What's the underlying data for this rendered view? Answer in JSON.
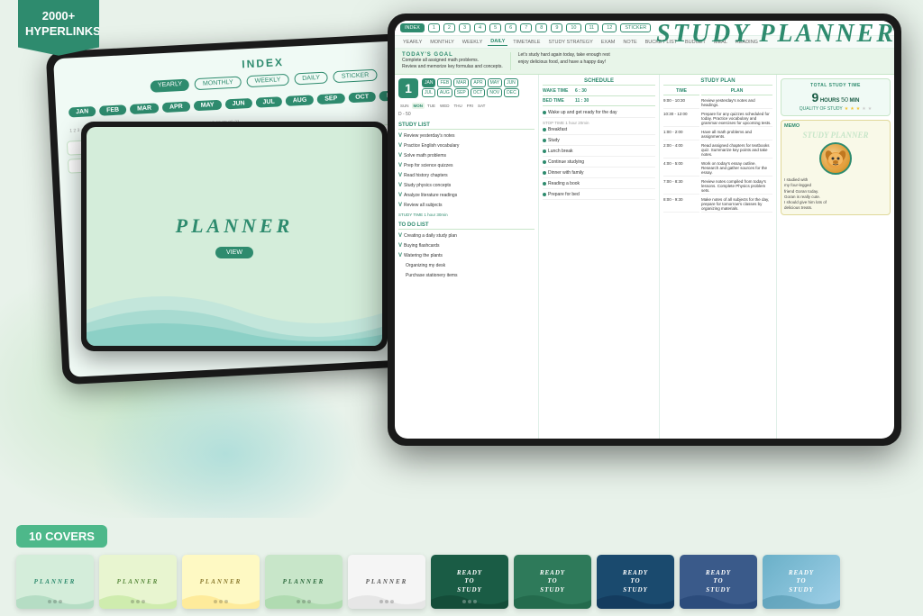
{
  "header": {
    "ribbon": "2000+\nHYPERLINKS",
    "title": "STUDY PLANNER"
  },
  "planner": {
    "nav_items": [
      "INDEX",
      "1",
      "2",
      "3",
      "4",
      "5",
      "6",
      "7",
      "8",
      "9",
      "10",
      "11",
      "12",
      "STICKER",
      "YEARLY",
      "MONTHLY",
      "WEEKLY",
      "DAILY",
      "TIMETABLE",
      "STUDY STRATEGY",
      "EXAM",
      "NOTE",
      "BUCKET LIST",
      "BUDGET",
      "MEAL",
      "READING"
    ],
    "date": "1",
    "months": [
      "JAN",
      "FEB",
      "MAR",
      "APR",
      "MAY",
      "JUN",
      "JUL",
      "AUG",
      "SEP",
      "OCT",
      "NOV",
      "DEC"
    ],
    "days": [
      "SUN",
      "MON",
      "TUE",
      "WED",
      "THU",
      "FRI",
      "SAT"
    ],
    "goal_label": "TODAY'S GOAL",
    "goal_text": "Complete all assigned math problems.\nReview and memorize key formulas and concepts.",
    "goal_right": "Let's study hard again today, take enough rest\nenjoy delicious food, and have a happy day!",
    "counter": "D - 50",
    "study_list_header": "STUDY LIST",
    "study_items": [
      "Review yesterday's notes",
      "Practice English vocabulary",
      "Solve math problems",
      "Prep for science quizzes",
      "Read history chapters",
      "Study physics concepts",
      "Analyze literature readings",
      "Review all subjects"
    ],
    "todo_header": "TO DO LIST",
    "todo_items": [
      "Creating a daily study plan",
      "Buying flashcards",
      "Watering the plants",
      "Organizing my desk",
      "Purchase stationery items"
    ],
    "schedule_header": "SCHEDULE",
    "wake_time": "6 : 30",
    "bed_time": "11 : 30",
    "schedule_items": [
      "Wake up and get ready for the day",
      "Breakfast",
      "Study",
      "Lunch break",
      "Continue studying",
      "Dinner with family",
      "Reading a book",
      "Prepare for bed"
    ],
    "study_plan_header": "STUDY PLAN",
    "time_slots": [
      "9:00 - 10:30",
      "10:30 - 12:00",
      "1:00 - 2:00",
      "2:00 - 4:00",
      "4:00 - 5:00",
      "7:00 - 8:30",
      "8:00 - 9:30"
    ],
    "plan_items": [
      "Review yesterday's notes and headings.",
      "Prepare for any quizzes scheduled for today. Practice vocabulary and grammar exercises for upcoming tests.",
      "Have all math problems and assignments.",
      "Read assigned chapters for textbooks quiz. Summarize key points and take notes.",
      "Work on today's essay outline. Research and gather sources for the essay.",
      "Review notes compiled from today's lessons. Complete Physics problem sets.",
      "Make notes of all subjects for the day, prepare for tomorrow's classes by organizing materials."
    ],
    "total_time_label": "TOTAL STUDY TIME",
    "total_hours": "9",
    "total_min": "50",
    "quality_label": "QUALITY OF STUDY",
    "memo_label": "MEMO",
    "memo_text": "I studied with\nmy four-legged\nfriend Goran today.\nGoran is really cute.\nI should give him lots of\ndelicious treats."
  },
  "covers_section": {
    "badge": "10 COVERS",
    "covers": [
      {
        "label": "PLANNER",
        "bg": "#d4edda",
        "text_color": "#2e8b6e",
        "type": "light"
      },
      {
        "label": "PLANNER",
        "bg": "#e8f5d0",
        "text_color": "#5a8a3e",
        "type": "light"
      },
      {
        "label": "PLANNER",
        "bg": "#fef9c3",
        "text_color": "#8a7a2e",
        "type": "light"
      },
      {
        "label": "PLANNER",
        "bg": "#c8e6c9",
        "text_color": "#2e6b3e",
        "type": "light"
      },
      {
        "label": "PLANNER",
        "bg": "#f5f5f5",
        "text_color": "#5a5a5a",
        "type": "light"
      },
      {
        "label": "READY\nTO\nSTUDY",
        "bg": "#1a5c45",
        "text_color": "#ffffff",
        "type": "dark"
      },
      {
        "label": "READY\nTO\nSTUDY",
        "bg": "#2e7a5a",
        "text_color": "#ffffff",
        "type": "dark"
      },
      {
        "label": "READY\nTO\nSTUDY",
        "bg": "#1a4a6e",
        "text_color": "#ffffff",
        "type": "dark"
      },
      {
        "label": "READY\nTO\nSTUDY",
        "bg": "#3a5a8a",
        "text_color": "#ffffff",
        "type": "dark"
      },
      {
        "label": "READY\nTO\nSTUDY",
        "bg": "#6ab0c8",
        "text_color": "#ffffff",
        "type": "dark"
      }
    ]
  }
}
